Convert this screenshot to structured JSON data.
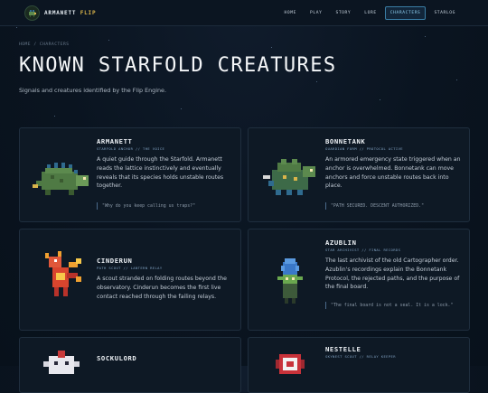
{
  "brand": {
    "name": "ARMANETT",
    "accent": "FLIP"
  },
  "nav": [
    {
      "label": "HOME",
      "active": false
    },
    {
      "label": "PLAY",
      "active": false
    },
    {
      "label": "STORY",
      "active": false
    },
    {
      "label": "LORE",
      "active": false
    },
    {
      "label": "CHARACTERS",
      "active": true
    },
    {
      "label": "STARLOG",
      "active": false
    }
  ],
  "breadcrumb": "HOME / CHARACTERS",
  "page_title": "KNOWN STARFOLD CREATURES",
  "subtitle": "Signals and creatures identified by the Flip Engine.",
  "cards": [
    {
      "name": "ARMANETT",
      "sub": "STARFOLD ANCHOR // THE VOICE",
      "desc": "A quiet guide through the Starfold. Armanett reads the lattice instinctively and eventually reveals that its species holds unstable routes together.",
      "quote": "\"Why do you keep calling us traps?\"",
      "icon": "armanett-sprite-icon"
    },
    {
      "name": "BONNETANK",
      "sub": "GUARDIAN FORM // PROTOCOL ACTIVE",
      "desc": "An armored emergency state triggered when an anchor is overwhelmed. Bonnetank can move anchors and force unstable routes back into place.",
      "quote": "\"PATH SECURED. DESCENT AUTHORIZED.\"",
      "icon": "bonnetank-sprite-icon"
    },
    {
      "name": "CINDERUN",
      "sub": "PATH SCOUT // LANTERN RELAY",
      "desc": "A scout stranded on folding routes beyond the observatory. Cinderun becomes the first live contact reached through the failing relays.",
      "quote": "",
      "icon": "cinderun-sprite-icon"
    },
    {
      "name": "AZUBLIN",
      "sub": "STAR ARCHIVIST // FINAL RECORDS",
      "desc": "The last archivist of the old Cartographer order. Azublin's recordings explain the Bonnetank Protocol, the rejected paths, and the purpose of the final board.",
      "quote": "\"The final board is not a seal. It is a lock.\"",
      "icon": "azublin-sprite-icon"
    },
    {
      "name": "SOCKULORD",
      "sub": "",
      "desc": "",
      "quote": "",
      "icon": "sockulord-sprite-icon"
    },
    {
      "name": "NESTELLE",
      "sub": "SKYNEST SCOUT // RELAY KEEPER",
      "desc": "",
      "quote": "",
      "icon": "nestelle-sprite-icon"
    }
  ]
}
